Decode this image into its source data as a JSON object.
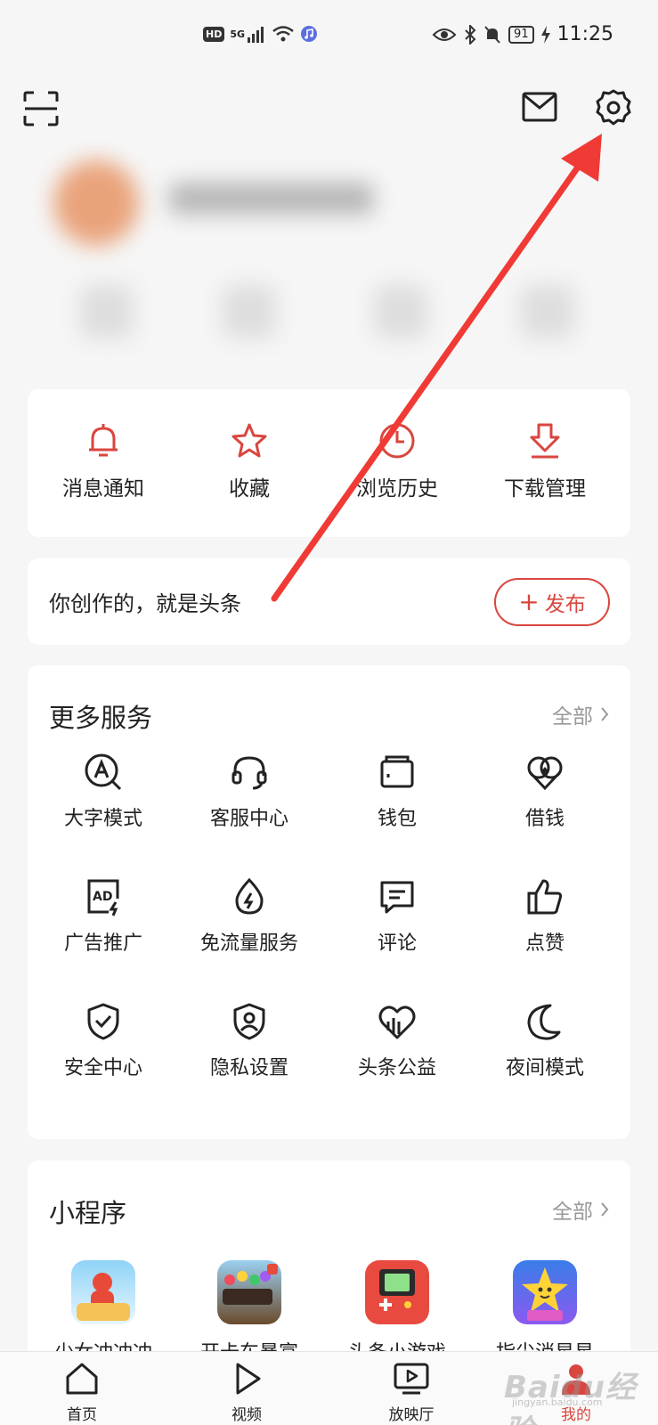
{
  "status_bar": {
    "network": "5G",
    "hd_badge": "HD",
    "battery": "91",
    "time": "11:25"
  },
  "quick_actions": [
    {
      "label": "消息通知",
      "icon": "bell-icon"
    },
    {
      "label": "收藏",
      "icon": "star-icon"
    },
    {
      "label": "浏览历史",
      "icon": "clock-icon"
    },
    {
      "label": "下载管理",
      "icon": "download-icon"
    }
  ],
  "create": {
    "text": "你创作的，就是头条",
    "publish_label": "发布"
  },
  "services": {
    "title": "更多服务",
    "all_label": "全部",
    "items": [
      {
        "label": "大字模式",
        "icon": "large-font-icon"
      },
      {
        "label": "客服中心",
        "icon": "headset-icon"
      },
      {
        "label": "钱包",
        "icon": "wallet-icon"
      },
      {
        "label": "借钱",
        "icon": "loan-icon"
      },
      {
        "label": "广告推广",
        "icon": "ad-icon"
      },
      {
        "label": "免流量服务",
        "icon": "data-free-icon"
      },
      {
        "label": "评论",
        "icon": "comment-icon"
      },
      {
        "label": "点赞",
        "icon": "thumbs-up-icon"
      },
      {
        "label": "安全中心",
        "icon": "shield-check-icon"
      },
      {
        "label": "隐私设置",
        "icon": "privacy-icon"
      },
      {
        "label": "头条公益",
        "icon": "charity-icon"
      },
      {
        "label": "夜间模式",
        "icon": "moon-icon"
      }
    ]
  },
  "mini_programs": {
    "title": "小程序",
    "all_label": "全部",
    "items": [
      {
        "label": "少女冲冲冲",
        "color": "#7ec8f2"
      },
      {
        "label": "开卡车暴富",
        "color": "#5a3a22"
      },
      {
        "label": "头条小游戏",
        "color": "#e94a3f"
      },
      {
        "label": "指尖消星星",
        "color": "#3a7de8"
      }
    ]
  },
  "tabs": [
    {
      "label": "首页",
      "icon": "home-icon"
    },
    {
      "label": "视频",
      "icon": "play-icon"
    },
    {
      "label": "放映厅",
      "icon": "tv-icon"
    },
    {
      "label": "我的",
      "icon": "profile-icon"
    }
  ],
  "watermark": {
    "brand": "Baidu经验",
    "url": "jingyan.baidu.com"
  },
  "colors": {
    "accent": "#d9463f",
    "annotation_arrow": "#f03a35"
  }
}
